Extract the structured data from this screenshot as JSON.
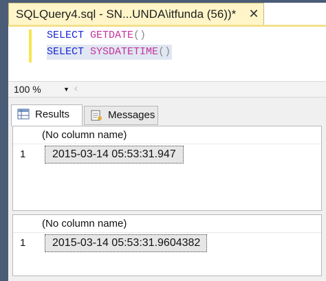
{
  "document_tab": {
    "title": "SQLQuery4.sql - SN...UNDA\\itfunda (56))*",
    "close_glyph": "✕"
  },
  "editor": {
    "lines": [
      {
        "keyword": "SELECT",
        "function": "GETDATE",
        "parens": "()"
      },
      {
        "keyword": "SELECT",
        "function": "SYSDATETIME",
        "parens": "()"
      }
    ]
  },
  "zoom": {
    "value": "100 %",
    "dropdown_icon": "dropdown-arrow",
    "scroll_glyph": "‹"
  },
  "tabs": [
    {
      "label": "Results",
      "icon": "grid-icon",
      "active": true
    },
    {
      "label": "Messages",
      "icon": "messages-icon",
      "active": false
    }
  ],
  "result_grids": [
    {
      "column_header": "(No column name)",
      "rows": [
        {
          "row_number": "1",
          "value": "2015-03-14 05:53:31.947"
        }
      ]
    },
    {
      "column_header": "(No column name)",
      "rows": [
        {
          "row_number": "1",
          "value": "2015-03-14 05:53:31.9604382"
        }
      ]
    }
  ],
  "colors": {
    "tab_background": "#fff5c8",
    "keyword": "#1c25d6",
    "function": "#c6329c",
    "frame": "#4b5c77"
  }
}
